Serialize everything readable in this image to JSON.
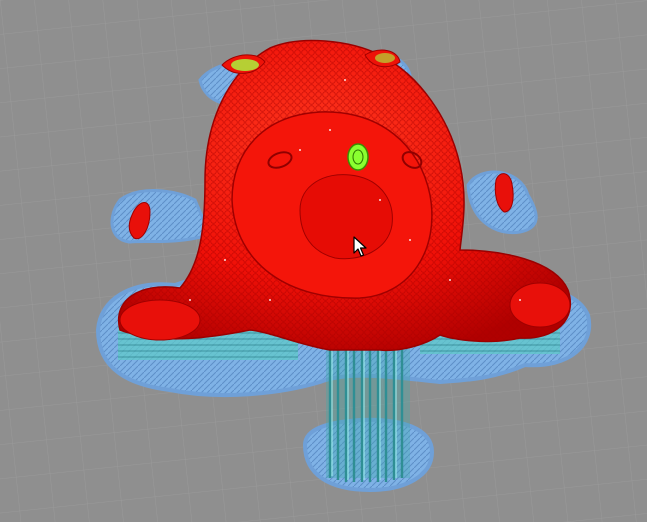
{
  "viewport": {
    "name": "slice-preview-viewport",
    "background_color": "#8f8f8f",
    "grid_color": "#9c9c9c"
  },
  "model": {
    "name": "layer-preview-model",
    "shell_color": "#ff1a0a",
    "shell_edge_color": "#b00000",
    "infill_color": "#7fff2a",
    "support_color": "#5fc8c8",
    "raft_color": "#7fb2e6"
  },
  "cursor": {
    "icon": "mouse-pointer-icon"
  }
}
